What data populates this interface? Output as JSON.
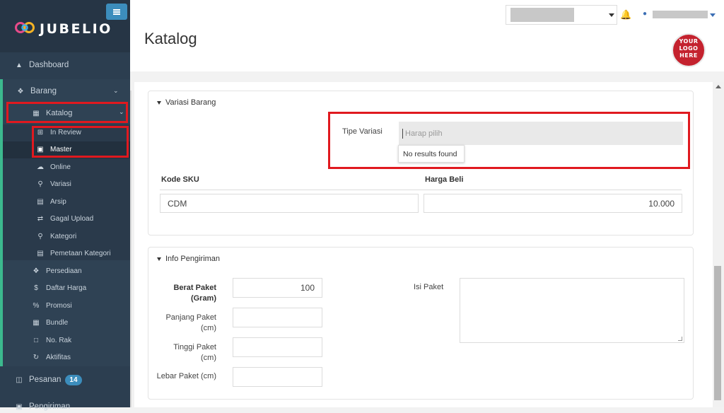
{
  "brand": {
    "name": "JUBELIO"
  },
  "header": {
    "title": "Katalog",
    "stamp": [
      "YOUR",
      "LOGO",
      "HERE"
    ]
  },
  "sidebar": {
    "dashboard": "Dashboard",
    "barang": "Barang",
    "katalog": "Katalog",
    "katalog_items": [
      "In Review",
      "Master",
      "Online",
      "Variasi",
      "Arsip",
      "Gagal Upload",
      "Kategori",
      "Pemetaan Kategori"
    ],
    "barang_items": [
      "Persediaan",
      "Daftar Harga",
      "Promosi",
      "Bundle",
      "No. Rak",
      "Aktifitas"
    ],
    "pesanan": "Pesanan",
    "pesanan_badge": "14",
    "pengiriman": "Pengiriman"
  },
  "variasi": {
    "title": "Variasi Barang",
    "tipe_label": "Tipe Variasi",
    "tipe_placeholder": "Harap pilih",
    "no_results": "No results found",
    "sku_header": "Kode SKU",
    "harga_header": "Harga Beli",
    "sku_value": "CDM",
    "harga_value": "10.000"
  },
  "pengiriman": {
    "title": "Info Pengiriman",
    "berat_label_1": "Berat Paket",
    "berat_label_2": "(Gram)",
    "berat_value": "100",
    "panjang_label_1": "Panjang Paket",
    "panjang_label_2": "(cm)",
    "tinggi_label_1": "Tinggi Paket",
    "tinggi_label_2": "(cm)",
    "lebar_label": "Lebar Paket (cm)",
    "isi_label": "Isi Paket"
  },
  "colors": {
    "sidebar": "#2c3e50",
    "accent": "#3cb98e",
    "highlight": "#e0191f",
    "badge": "#3c8dbc"
  }
}
